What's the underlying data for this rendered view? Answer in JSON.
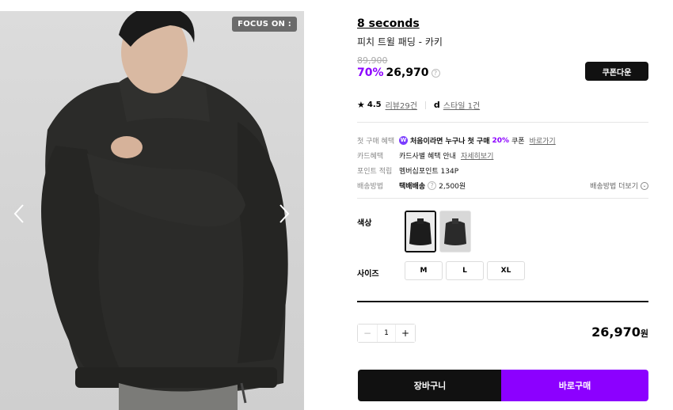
{
  "gallery": {
    "badge": "FOCUS ON :"
  },
  "product": {
    "brand": "8 seconds",
    "name": "피치 트윌 패딩 - 카키",
    "original_price": "89,900",
    "discount": "70%",
    "price": "26,970",
    "coupon_label": "쿠폰다운"
  },
  "rating": {
    "score": "4.5",
    "reviews": "리뷰29건",
    "style_icon": "d",
    "style": "스타일 1건"
  },
  "benefits": {
    "first_purchase": {
      "key": "첫 구매 혜택",
      "text_a": "처음이라면 누구나 첫 구매",
      "percent": "20%",
      "text_b": "쿠폰",
      "link": "바로가기"
    },
    "card": {
      "key": "카드혜택",
      "text": "카드사별 혜택 안내",
      "link": "자세히보기"
    },
    "point": {
      "key": "포인트 적립",
      "text": "멤버십포인트 134P"
    },
    "shipping": {
      "key": "배송방법",
      "method": "택배배송",
      "fee": "2,500원",
      "more": "배송방법 더보기"
    }
  },
  "options": {
    "color_label": "색상",
    "size_label": "사이즈",
    "sizes": [
      "M",
      "L",
      "XL"
    ]
  },
  "quantity": {
    "minus": "−",
    "value": "1",
    "plus": "+"
  },
  "total": {
    "value": "26,970",
    "unit": "원"
  },
  "actions": {
    "cart": "장바구니",
    "buy": "바로구매"
  },
  "colors": {
    "accent": "#8c00ff",
    "dark": "#111111"
  }
}
